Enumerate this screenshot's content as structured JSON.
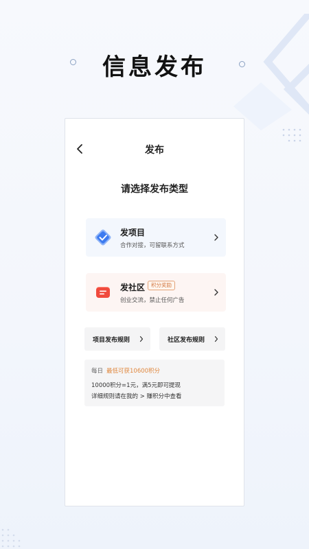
{
  "hero": {
    "title": "信息发布"
  },
  "nav": {
    "title": "发布"
  },
  "section": {
    "title": "请选择发布类型"
  },
  "cards": [
    {
      "title": "发项目",
      "subtitle": "合作对接，可留联系方式",
      "icon": "project-check-icon"
    },
    {
      "title": "发社区",
      "badge": "积分奖励",
      "subtitle": "创业交流，禁止任何广告",
      "icon": "community-chat-icon"
    }
  ],
  "rules": [
    {
      "label": "项目发布规则"
    },
    {
      "label": "社区发布规则"
    }
  ],
  "info": {
    "prefix": "每日",
    "highlight": "最低可获10600积分",
    "line2": "10000积分=1元，满5元即可提现",
    "line3": "详细规则请在我的 > 赚积分中查看"
  },
  "colors": {
    "accent_orange": "#e0883f",
    "project_card_bg": "#f3f7fd",
    "community_card_bg": "#fdf5f3",
    "project_icon": "#3d7bf0",
    "community_icon": "#f04a3d"
  }
}
